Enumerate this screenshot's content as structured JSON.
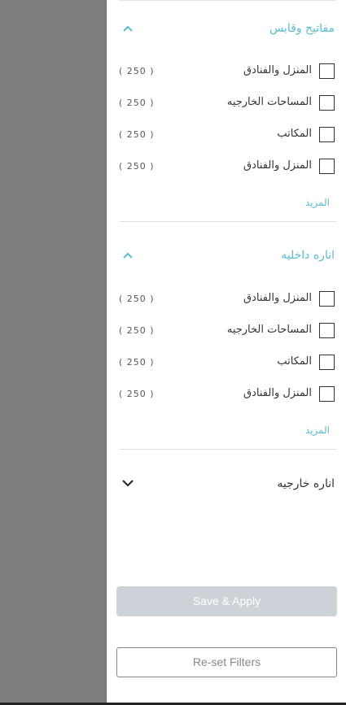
{
  "sections": [
    {
      "title": "مفاتيح وقابس",
      "expanded": true,
      "items": [
        {
          "label": "المنزل والفنادق",
          "count": "( 250 )"
        },
        {
          "label": "المساحات الخارجيه",
          "count": "( 250 )"
        },
        {
          "label": "المكاتب",
          "count": "( 250 )"
        },
        {
          "label": "المنزل والفنادق",
          "count": "( 250 )"
        }
      ],
      "more_label": "المزيد"
    },
    {
      "title": "اناره داخليه",
      "expanded": true,
      "items": [
        {
          "label": "المنزل والفنادق",
          "count": "( 250 )"
        },
        {
          "label": "المساحات الخارجيه",
          "count": "( 250 )"
        },
        {
          "label": "المكاتب",
          "count": "( 250 )"
        },
        {
          "label": "المنزل والفنادق",
          "count": "( 250 )"
        }
      ],
      "more_label": "المزيد"
    },
    {
      "title": "اناره خارجيه",
      "expanded": false
    }
  ],
  "buttons": {
    "save_apply": "Save & Apply",
    "reset": "Re-set Filters"
  },
  "colors": {
    "accent": "#5bbccf",
    "overlay": "#7d7d7d",
    "save_disabled": "#cdd2d9"
  }
}
